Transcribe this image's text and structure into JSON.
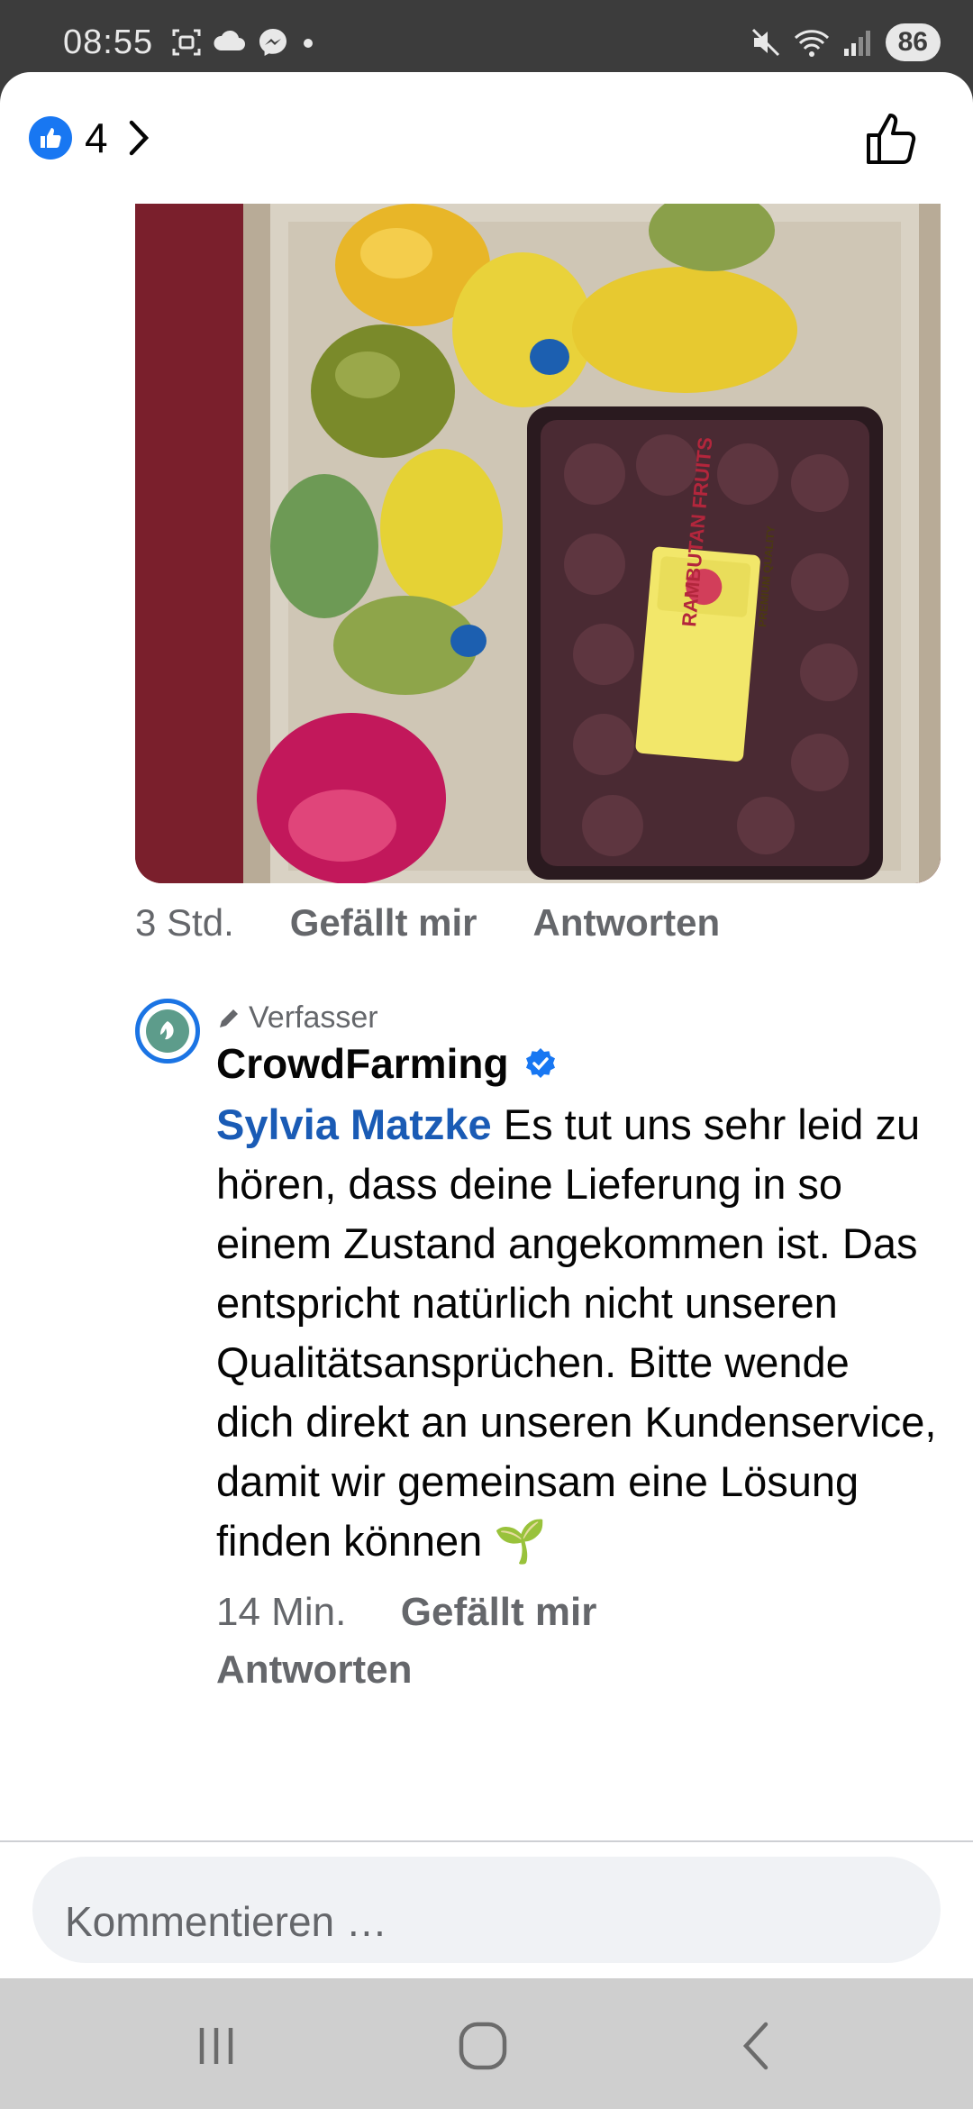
{
  "status_bar": {
    "time": "08:55",
    "battery": "86",
    "left_icons": [
      "screenshot-icon",
      "cloud-icon",
      "messenger-icon",
      "dot-icon"
    ],
    "right_icons": [
      "mute-icon",
      "wifi-icon",
      "signal-icon"
    ]
  },
  "header": {
    "reaction_count": "4",
    "reaction_icon": "like-badge-icon",
    "chevron_icon": "chevron-right-icon",
    "like_action_icon": "thumbs-up-outline-icon"
  },
  "photo": {
    "label_text": "RAMBUTAN FRUITS",
    "label_premium": "PREMIUM QUALITY"
  },
  "comment_meta": {
    "time": "3 Std.",
    "like": "Gefällt mir",
    "reply": "Antworten"
  },
  "reply": {
    "author_badge": "Verfasser",
    "author_name": "CrowdFarming",
    "mention": "Sylvia Matzke",
    "text": " Es tut uns sehr leid zu hören, dass deine Lieferung in so einem Zustand angekommen ist. Das entspricht natürlich nicht unseren Qualitätsansprüchen. Bitte wende dich direkt an unseren Kundenservice, damit wir gemeinsam eine Lösung finden können ",
    "emoji": "🌱",
    "time": "14 Min.",
    "like": "Gefällt mir",
    "reply": "Antworten"
  },
  "composer": {
    "placeholder": "Kommentieren …"
  },
  "colors": {
    "accent": "#1877f2",
    "mention": "#1a5bb5",
    "secondary_text": "#65676b"
  }
}
